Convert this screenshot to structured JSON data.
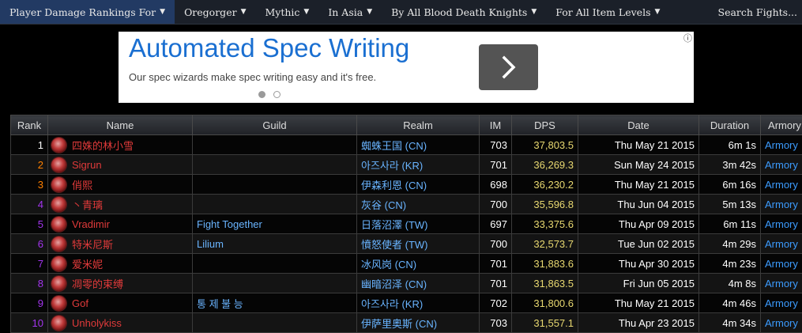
{
  "nav": {
    "items": [
      {
        "label": "Player Damage Rankings For",
        "active": true
      },
      {
        "label": "Oregorger",
        "active": false
      },
      {
        "label": "Mythic",
        "active": false
      },
      {
        "label": "In Asia",
        "active": false
      },
      {
        "label": "By All Blood Death Knights",
        "active": false
      },
      {
        "label": "For All Item Levels",
        "active": false
      }
    ],
    "search_label": "Search Fights..."
  },
  "ad": {
    "title": "Automated Spec Writing",
    "text": "Our spec wizards make spec writing easy and it's free.",
    "info": "ⓘ",
    "arrow": "›"
  },
  "table": {
    "headers": [
      "Rank",
      "Name",
      "Guild",
      "Realm",
      "IM",
      "DPS",
      "Date",
      "Duration",
      "Armory"
    ],
    "rows": [
      {
        "rank": "1",
        "rank_color": "#ffffff",
        "name": "四姝的林小雪",
        "guild": "",
        "realm": "蜘蛛王国 (CN)",
        "im": "703",
        "dps": "37,803.5",
        "date": "Thu May 21 2015",
        "duration": "6m 1s",
        "armory": "Armory"
      },
      {
        "rank": "2",
        "rank_color": "#ff8000",
        "name": "Sigrun",
        "guild": "",
        "realm": "아즈사라 (KR)",
        "im": "701",
        "dps": "36,269.3",
        "date": "Sun May 24 2015",
        "duration": "3m 42s",
        "armory": "Armory"
      },
      {
        "rank": "3",
        "rank_color": "#ff8000",
        "name": "俏熙",
        "guild": "",
        "realm": "伊森利恩 (CN)",
        "im": "698",
        "dps": "36,230.2",
        "date": "Thu May 21 2015",
        "duration": "6m 16s",
        "armory": "Armory"
      },
      {
        "rank": "4",
        "rank_color": "#a335ee",
        "name": "丶青璃",
        "guild": "",
        "realm": "灰谷 (CN)",
        "im": "700",
        "dps": "35,596.8",
        "date": "Thu Jun 04 2015",
        "duration": "5m 13s",
        "armory": "Armory"
      },
      {
        "rank": "5",
        "rank_color": "#a335ee",
        "name": "Vradimir",
        "guild": "Fight Together",
        "realm": "日落沼澤 (TW)",
        "im": "697",
        "dps": "33,375.6",
        "date": "Thu Apr 09 2015",
        "duration": "6m 11s",
        "armory": "Armory"
      },
      {
        "rank": "6",
        "rank_color": "#a335ee",
        "name": "特米尼斯",
        "guild": "Lilium",
        "realm": "憤怒使者 (TW)",
        "im": "700",
        "dps": "32,573.7",
        "date": "Tue Jun 02 2015",
        "duration": "4m 29s",
        "armory": "Armory"
      },
      {
        "rank": "7",
        "rank_color": "#a335ee",
        "name": "爱米妮",
        "guild": "",
        "realm": "冰风岗 (CN)",
        "im": "701",
        "dps": "31,883.6",
        "date": "Thu Apr 30 2015",
        "duration": "4m 23s",
        "armory": "Armory"
      },
      {
        "rank": "8",
        "rank_color": "#a335ee",
        "name": "凋零的束缚",
        "guild": "",
        "realm": "幽暗沼泽 (CN)",
        "im": "701",
        "dps": "31,863.5",
        "date": "Fri Jun 05 2015",
        "duration": "4m 8s",
        "armory": "Armory"
      },
      {
        "rank": "9",
        "rank_color": "#a335ee",
        "name": "Gof",
        "guild": "통 제 불 능",
        "realm": "아즈사라 (KR)",
        "im": "702",
        "dps": "31,800.6",
        "date": "Thu May 21 2015",
        "duration": "4m 46s",
        "armory": "Armory"
      },
      {
        "rank": "10",
        "rank_color": "#a335ee",
        "name": "Unholykiss",
        "guild": "",
        "realm": "伊萨里奥斯 (CN)",
        "im": "703",
        "dps": "31,557.1",
        "date": "Thu Apr 23 2015",
        "duration": "4m 34s",
        "armory": "Armory"
      }
    ]
  }
}
